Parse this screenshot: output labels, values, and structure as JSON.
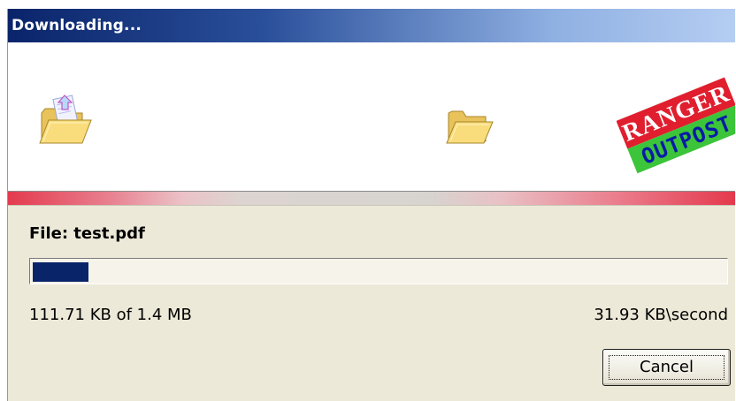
{
  "window": {
    "title": "Downloading..."
  },
  "banner": {
    "source_icon": "open-folder-with-document-icon",
    "destination_icon": "open-folder-icon",
    "logo": {
      "text_top": "RANGER",
      "text_bottom": "OUTPOST"
    }
  },
  "download": {
    "file_label": "File: test.pdf",
    "progress_fraction": 0.08,
    "size_status": "111.71 KB of 1.4 MB",
    "speed_status": "31.93 KB\\second"
  },
  "actions": {
    "cancel_label": "Cancel"
  },
  "colors": {
    "title_bar_start": "#0a246a",
    "title_bar_end": "#b5cdf2",
    "progress_fill": "#0a246a",
    "separator_accent": "#e43a4e",
    "dialog_background": "#ece9d8"
  }
}
